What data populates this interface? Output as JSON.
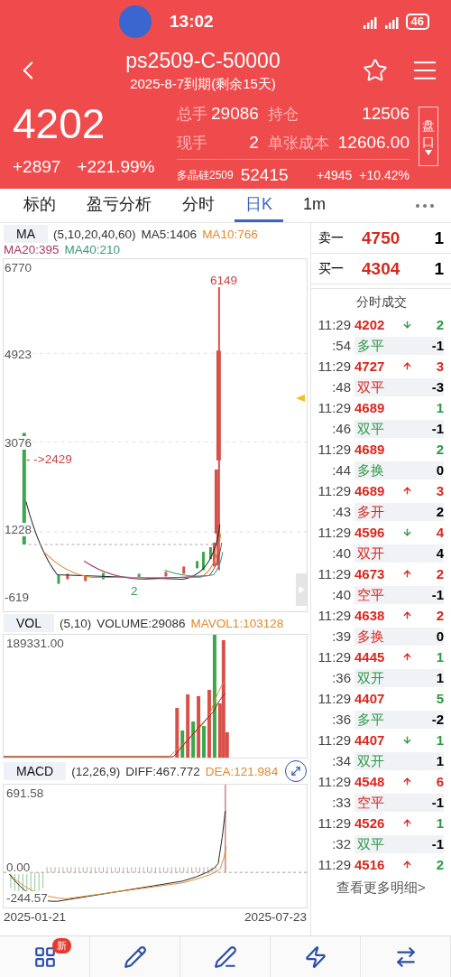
{
  "status_bar": {
    "time": "13:02",
    "battery": "46"
  },
  "header": {
    "title": "ps2509-C-50000",
    "subtitle": "2025-8-7到期(剩余15天)",
    "price": "4202",
    "change": "+2897",
    "change_pct": "+221.99%",
    "stats": [
      {
        "label": "总手",
        "value": "29086"
      },
      {
        "label": "持仓",
        "value": "12506"
      },
      {
        "label": "现手",
        "value": "2"
      },
      {
        "label": "单张成本",
        "value": "12606.00"
      }
    ],
    "underlying": {
      "name": "多晶硅2509",
      "price": "52415",
      "change": "+4945",
      "change_pct": "+10.42%"
    },
    "side_button": "盘口"
  },
  "tabs": [
    {
      "label": "标的",
      "selected": false
    },
    {
      "label": "盈亏分析",
      "selected": false
    },
    {
      "label": "分时",
      "selected": false
    },
    {
      "label": "日K",
      "selected": true
    },
    {
      "label": "1m",
      "selected": false
    }
  ],
  "main_chart": {
    "indicator": "MA",
    "params": "(5,10,20,40,60)",
    "legend": [
      {
        "text": "MA5:1406",
        "color": "#333333"
      },
      {
        "text": "MA10:766",
        "color": "#e08a2c"
      },
      {
        "text": "MA20:395",
        "color": "#a8385e"
      },
      {
        "text": "MA40:210",
        "color": "#3a9a7a"
      }
    ],
    "y_labels": [
      "6770",
      "4923",
      "3076",
      "1228",
      "-619"
    ],
    "high_label": "6149",
    "marker_label": "- ->2429",
    "low_label": "2"
  },
  "volume_chart": {
    "indicator": "VOL",
    "params": "(5,10)",
    "legend": [
      {
        "text": "VOLUME:29086",
        "color": "#333333"
      },
      {
        "text": "MAVOL1:103128",
        "color": "#e08a2c"
      }
    ],
    "y_label": "189331.00"
  },
  "macd_chart": {
    "indicator": "MACD",
    "params": "(12,26,9)",
    "legend": [
      {
        "text": "DIFF:467.772",
        "color": "#333333"
      },
      {
        "text": "DEA:121.984",
        "color": "#e08a2c"
      }
    ],
    "y_labels": [
      "691.58",
      "0.00",
      "-244.57"
    ],
    "x_labels": [
      "2025-01-21",
      "2025-07-23"
    ]
  },
  "order_book": [
    {
      "label": "卖一",
      "price": "4750",
      "volume": "1"
    },
    {
      "label": "买一",
      "price": "4304",
      "volume": "1"
    }
  ],
  "trades_title": "分时成交",
  "trades": [
    {
      "time": "11:29",
      "seconds": ":54",
      "price": "4202",
      "kind": "down",
      "volume": {
        "text": "2",
        "color": "#2e9a44"
      },
      "action": {
        "text": "多平",
        "color": "#2e9a44"
      },
      "oi": "-1"
    },
    {
      "time": "11:29",
      "seconds": ":48",
      "price": "4727",
      "kind": "up",
      "volume": {
        "text": "3",
        "color": "#d8281e"
      },
      "action": {
        "text": "双平",
        "color": "#d8281e"
      },
      "oi": "-3"
    },
    {
      "time": "11:29",
      "seconds": ":46",
      "price": "4689",
      "kind": "flat",
      "volume": {
        "text": "1",
        "color": "#2e9a44"
      },
      "action": {
        "text": "双平",
        "color": "#2e9a44"
      },
      "oi": "-1"
    },
    {
      "time": "11:29",
      "seconds": ":44",
      "price": "4689",
      "kind": "flat",
      "volume": {
        "text": "2",
        "color": "#2e9a44"
      },
      "action": {
        "text": "多换",
        "color": "#2e9a44"
      },
      "oi": "0"
    },
    {
      "time": "11:29",
      "seconds": ":43",
      "price": "4689",
      "kind": "up",
      "volume": {
        "text": "3",
        "color": "#d8281e"
      },
      "action": {
        "text": "多开",
        "color": "#d8281e"
      },
      "oi": "2"
    },
    {
      "time": "11:29",
      "seconds": ":40",
      "price": "4596",
      "kind": "down",
      "volume": {
        "text": "4",
        "color": "#d8281e"
      },
      "action": {
        "text": "双开",
        "color": "#d8281e"
      },
      "oi": "4"
    },
    {
      "time": "11:29",
      "seconds": ":40",
      "price": "4673",
      "kind": "up",
      "volume": {
        "text": "2",
        "color": "#d8281e"
      },
      "action": {
        "text": "空平",
        "color": "#d8281e"
      },
      "oi": "-1"
    },
    {
      "time": "11:29",
      "seconds": ":39",
      "price": "4638",
      "kind": "up",
      "volume": {
        "text": "2",
        "color": "#d8281e"
      },
      "action": {
        "text": "多换",
        "color": "#d8281e"
      },
      "oi": "0"
    },
    {
      "time": "11:29",
      "seconds": ":36",
      "price": "4445",
      "kind": "up",
      "volume": {
        "text": "1",
        "color": "#2e9a44"
      },
      "action": {
        "text": "双开",
        "color": "#2e9a44"
      },
      "oi": "1"
    },
    {
      "time": "11:29",
      "seconds": ":36",
      "price": "4407",
      "kind": "flat",
      "volume": {
        "text": "5",
        "color": "#2e9a44"
      },
      "action": {
        "text": "多平",
        "color": "#2e9a44"
      },
      "oi": "-2"
    },
    {
      "time": "11:29",
      "seconds": ":34",
      "price": "4407",
      "kind": "down",
      "volume": {
        "text": "1",
        "color": "#2e9a44"
      },
      "action": {
        "text": "双开",
        "color": "#2e9a44"
      },
      "oi": "1"
    },
    {
      "time": "11:29",
      "seconds": ":33",
      "price": "4548",
      "kind": "up",
      "volume": {
        "text": "6",
        "color": "#d8281e"
      },
      "action": {
        "text": "空平",
        "color": "#d8281e"
      },
      "oi": "-1"
    },
    {
      "time": "11:29",
      "seconds": ":32",
      "price": "4526",
      "kind": "up",
      "volume": {
        "text": "1",
        "color": "#2e9a44"
      },
      "action": {
        "text": "双平",
        "color": "#2e9a44"
      },
      "oi": "-1"
    },
    {
      "time": "11:29",
      "price": "4516",
      "kind": "up",
      "volume": {
        "text": "2",
        "color": "#2e9a44"
      }
    }
  ],
  "more_link": "查看更多明细>",
  "bottom_nav": [
    {
      "kind": "grid",
      "badge": "新"
    },
    {
      "kind": "pencil"
    },
    {
      "kind": "edit"
    },
    {
      "kind": "flash"
    },
    {
      "kind": "exchange"
    }
  ]
}
